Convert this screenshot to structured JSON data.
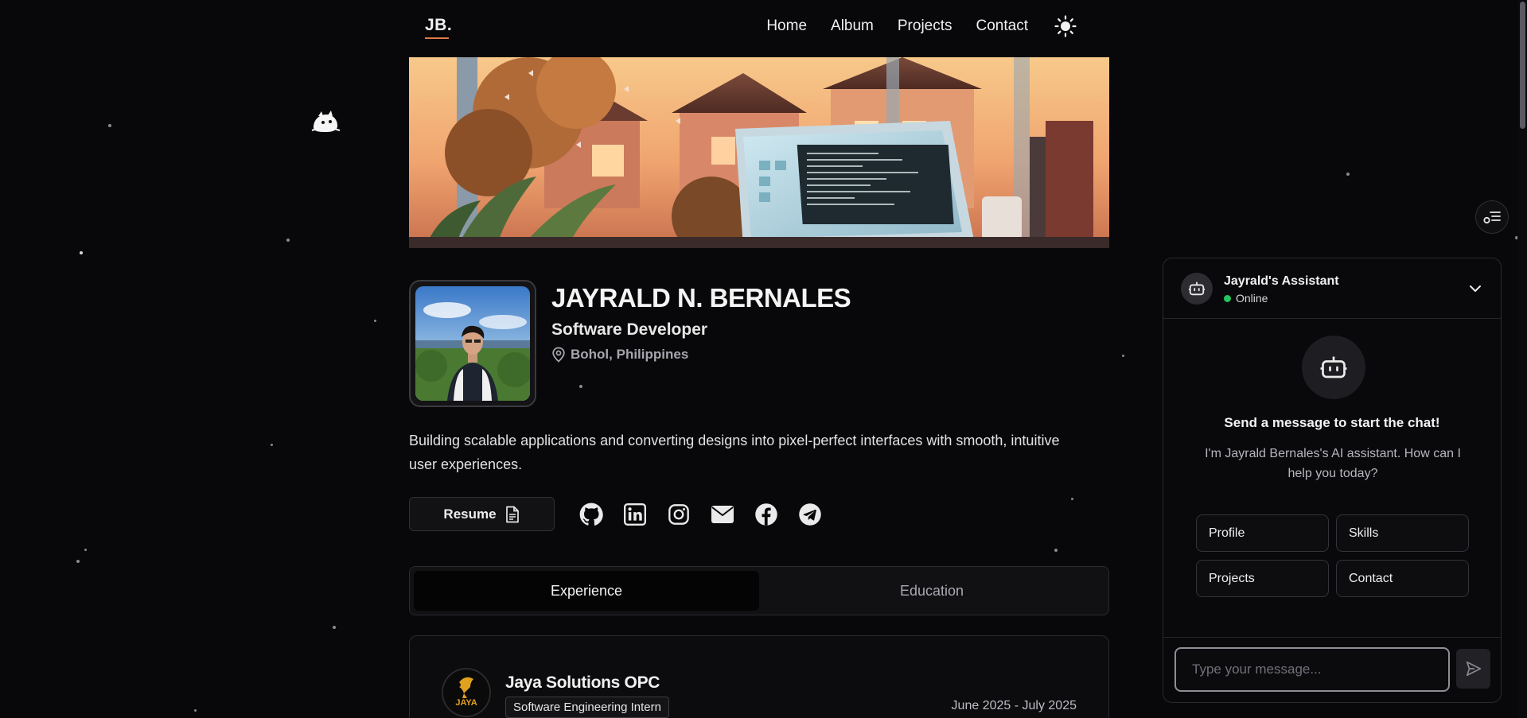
{
  "nav": {
    "logo": "JB.",
    "links": [
      "Home",
      "Album",
      "Projects",
      "Contact"
    ],
    "theme_icon": "sun-icon"
  },
  "profile": {
    "name": "JAYRALD N. BERNALES",
    "role": "Software Developer",
    "location": "Bohol, Philippines",
    "bio": "Building scalable applications and converting designs into pixel-perfect interfaces with smooth, intuitive user experiences."
  },
  "actions": {
    "resume_label": "Resume",
    "socials": [
      "github-icon",
      "linkedin-icon",
      "instagram-icon",
      "email-icon",
      "facebook-icon",
      "telegram-icon"
    ]
  },
  "tabs": [
    "Experience",
    "Education"
  ],
  "experience": [
    {
      "company": "Jaya Solutions OPC",
      "logo_text": "JAYA",
      "title": "Software Engineering Intern",
      "dates": "June 2025 - July 2025"
    }
  ],
  "chat": {
    "title": "Jayrald's Assistant",
    "status": "Online",
    "heading": "Send a message to start the chat!",
    "subtext": "I'm Jayrald Bernales's AI assistant. How can I help you today?",
    "chips": [
      "Profile",
      "Skills",
      "Projects",
      "Contact"
    ],
    "placeholder": "Type your message..."
  },
  "colors": {
    "background": "#08080a",
    "accent": "#e0794a",
    "online": "#22c55e"
  }
}
